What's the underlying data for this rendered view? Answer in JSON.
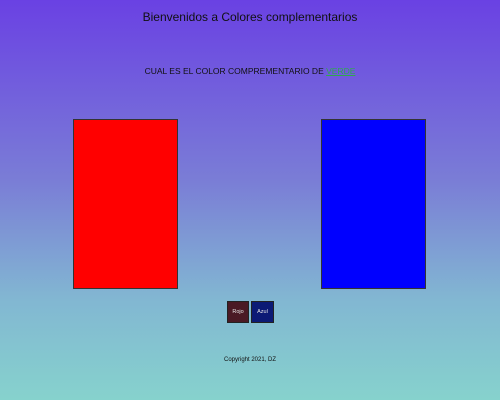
{
  "header": {
    "title": "Bienvenidos a Colores complementarios"
  },
  "question": {
    "prefix": "CUAL ES EL COLOR COMPREMENTARIO DE",
    "target_color_name": "VERDE",
    "target_color_hex": "#2fa84f"
  },
  "swatches": [
    {
      "name": "swatch-red",
      "color": "#ff0000"
    },
    {
      "name": "swatch-blue",
      "color": "#0000ff"
    }
  ],
  "buttons": [
    {
      "label": "Rojo",
      "bg": "#4a1a25"
    },
    {
      "label": "Azul",
      "bg": "#0c1a75"
    }
  ],
  "footer": {
    "copyright": "Copyright 2021, DZ"
  }
}
